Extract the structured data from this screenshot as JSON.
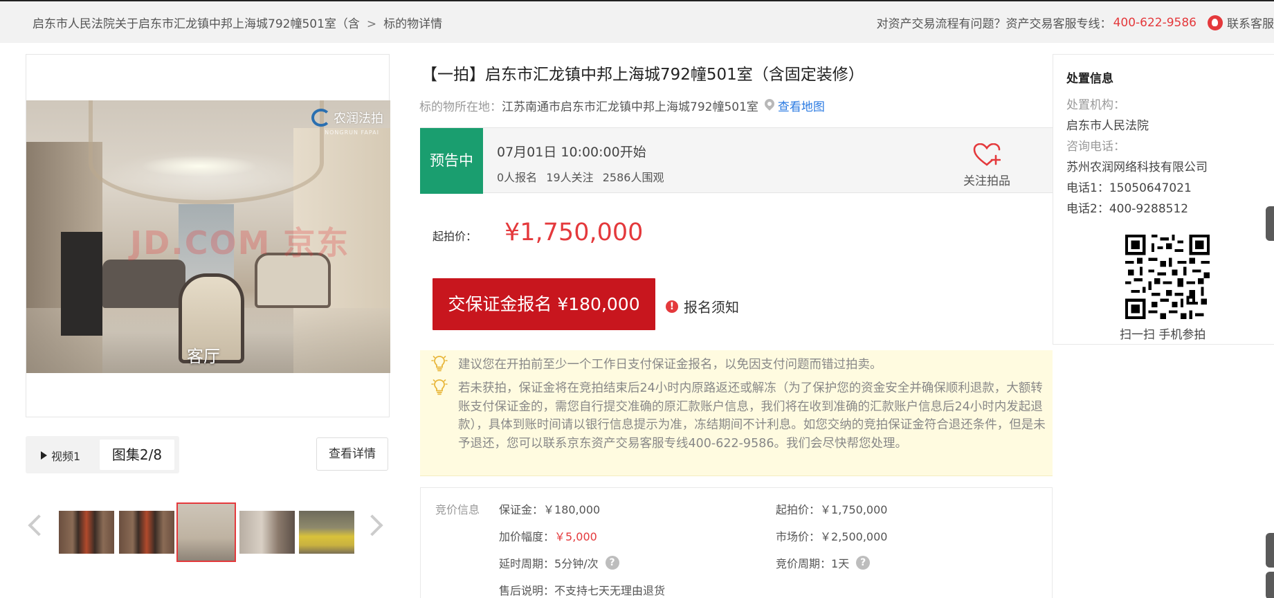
{
  "breadcrumb": {
    "item1": "启东市人民法院关于启东市汇龙镇中邦上海城792幢501室（含",
    "separator": ">",
    "item2": "标的物详情"
  },
  "header": {
    "question": "对资产交易流程有问题？资产交易客服专线：",
    "phone": "400-622-9586",
    "contact_label": "联系客服"
  },
  "gallery": {
    "room_label": "客厅",
    "watermark_brand": "农润法拍",
    "watermark_brand_en": "NONGRUN FAPAI",
    "watermark_center": "JD.COM 京东",
    "video_tab": "视频1",
    "album_tab": "图集2/8",
    "detail_button": "查看详情",
    "thumbnails_count": 5,
    "active_thumbnail": 3
  },
  "item": {
    "title": "【一拍】启东市汇龙镇中邦上海城792幢501室（含固定装修）",
    "location_label": "标的物所在地：",
    "location": "江苏南通市启东市汇龙镇中邦上海城792幢501室",
    "map_link": "查看地图"
  },
  "status": {
    "badge": "预告中",
    "start_time": "07月01日 10:00:00开始",
    "signups": "0人报名",
    "followers": "19人关注",
    "viewers": "2586人围观",
    "follow_label": "关注拍品"
  },
  "price": {
    "start_label": "起拍价：",
    "start_value": "¥1,750,000",
    "deposit_button": "交保证金报名 ¥180,000",
    "notice": "报名须知"
  },
  "tips": [
    "建议您在开拍前至少一个工作日支付保证金报名，以免因支付问题而错过拍卖。",
    "若未获拍，保证金将在竞拍结束后24小时内原路返还或解冻（为了保护您的资金安全并确保顺利退款，大额转账支付保证金的，需您自行提交准确的原汇款账户信息，我们将在收到准确的汇款账户信息后24小时内发起退款），具体到账时间请以银行信息提示为准，冻结期间不计利息。如您交纳的竞拍保证金符合退还条件，但是未予退还，您可以联系京东资产交易客服专线400-622-9586。我们会尽快帮您处理。"
  ],
  "bid_info": {
    "title": "竞价信息",
    "deposit_label": "保证金：",
    "deposit_value": "￥180,000",
    "start_label": "起拍价：",
    "start_value": "￥1,750,000",
    "increment_label": "加价幅度：",
    "increment_value": "￥5,000",
    "market_label": "市场价：",
    "market_value": "￥2,500,000",
    "delay_label": "延时周期：",
    "delay_value": "5分钟/次",
    "cycle_label": "竞价周期：",
    "cycle_value": "1天",
    "aftersale_label": "售后说明：",
    "aftersale_value": "不支持七天无理由退货"
  },
  "disposal": {
    "title": "处置信息",
    "org_label": "处置机构：",
    "org_value": "启东市人民法院",
    "consult_label": "咨询电话：",
    "consult_value": "苏州农润网络科技有限公司",
    "phone1": "电话1：15050647021",
    "phone2": "电话2：400-9288512",
    "qr_caption": "扫一扫 手机参拍"
  },
  "colors": {
    "accent_red": "#e4393c",
    "button_red": "#c8161e",
    "status_green": "#1a9e6f",
    "link_blue": "#2a7ae2",
    "tips_bg": "#fffbe0"
  }
}
